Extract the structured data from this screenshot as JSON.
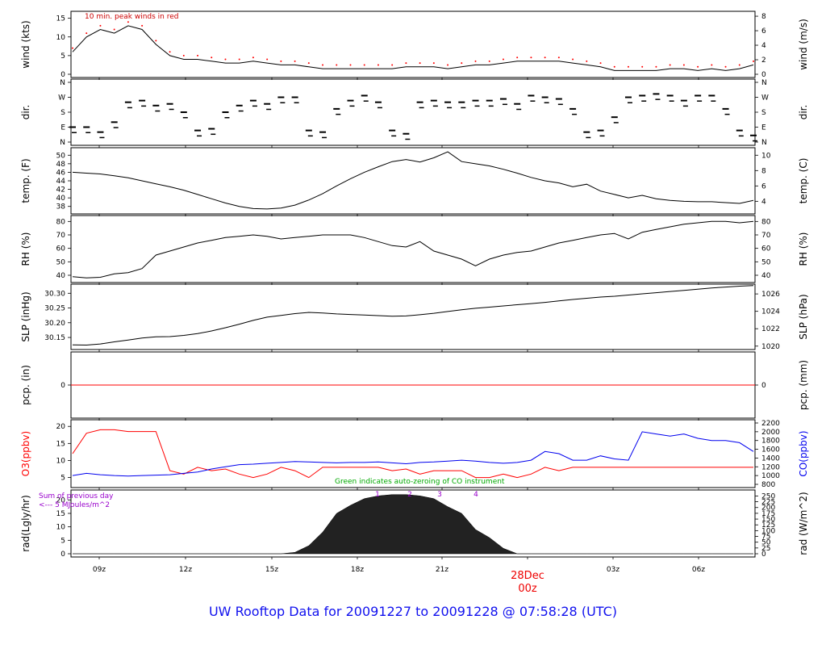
{
  "chart_data": {
    "type": "line",
    "time_ticks": [
      "09z",
      "12z",
      "15z",
      "18z",
      "21z",
      "",
      "03z",
      "06z"
    ],
    "date_label": "28Dec",
    "midnight_label": "00z",
    "panels": [
      {
        "id": "wind",
        "ylabel_left": "wind (kts)",
        "ylabel_right": "wind (m/s)",
        "left_ticks": [
          0,
          5,
          10,
          15
        ],
        "right_ticks": [
          0,
          2,
          4,
          6,
          8
        ],
        "ylim": [
          0,
          16
        ],
        "annotation": "10 min. peak winds in red",
        "series": [
          {
            "values": [
              6,
              10,
              12,
              11,
              13,
              12,
              8,
              5,
              4,
              4,
              3.5,
              3,
              3,
              3.5,
              3,
              2.5,
              2.5,
              2,
              1.5,
              1.5,
              1.5,
              1.5,
              1.5,
              1.5,
              2,
              2,
              2,
              1.5,
              2,
              2.5,
              2.5,
              3,
              3.5,
              3.5,
              3.5,
              3.5,
              3,
              2.5,
              2,
              1,
              1,
              1,
              1,
              1.5,
              1.5,
              1,
              1.5,
              1,
              1.5,
              2.5
            ]
          }
        ]
      },
      {
        "id": "dir",
        "ylabel_left": "dir.",
        "ylabel_right": "dir.",
        "left_ticks": [
          "N",
          "E",
          "S",
          "W",
          "N"
        ],
        "right_ticks": [
          "N",
          "E",
          "S",
          "W",
          "N"
        ],
        "ylim": [
          0,
          360
        ],
        "series": [
          {
            "values": [
              90,
              90,
              60,
              120,
              240,
              250,
              220,
              230,
              180,
              70,
              80,
              180,
              220,
              250,
              230,
              270,
              270,
              70,
              60,
              200,
              250,
              280,
              240,
              70,
              50,
              240,
              250,
              240,
              240,
              250,
              250,
              260,
              230,
              280,
              270,
              260,
              200,
              60,
              70,
              150,
              270,
              280,
              290,
              280,
              250,
              280,
              280,
              200,
              70,
              40
            ]
          }
        ]
      },
      {
        "id": "temp",
        "ylabel_left": "temp. (F)",
        "ylabel_right": "temp. (C)",
        "left_ticks": [
          38,
          40,
          42,
          44,
          46,
          48,
          50
        ],
        "right_ticks": [
          4,
          6,
          8,
          10
        ],
        "ylim": [
          37,
          51
        ],
        "series": [
          {
            "values": [
              46,
              45.8,
              45.6,
              45.2,
              44.7,
              44,
              43.3,
              42.6,
              41.8,
              40.8,
              39.8,
              38.8,
              38,
              37.5,
              37.4,
              37.6,
              38.3,
              39.5,
              41,
              42.8,
              44.5,
              46,
              47.3,
              48.5,
              49,
              48.4,
              49.4,
              50.8,
              48.5,
              48,
              47.5,
              46.7,
              45.8,
              44.8,
              44,
              43.5,
              42.6,
              43.2,
              41.6,
              40.8,
              40,
              40.6,
              39.8,
              39.4,
              39.2,
              39.1,
              39.1,
              38.9,
              38.7,
              39.4
            ]
          }
        ]
      },
      {
        "id": "rh",
        "ylabel_left": "RH (%)",
        "ylabel_right": "RH (%)",
        "left_ticks": [
          40,
          50,
          60,
          70,
          80
        ],
        "right_ticks": [
          40,
          50,
          60,
          70,
          80
        ],
        "ylim": [
          37,
          82
        ],
        "series": [
          {
            "values": [
              39,
              38,
              38.5,
              41,
              42,
              45,
              55,
              58,
              61,
              64,
              66,
              68,
              69,
              70,
              69,
              67,
              68,
              69,
              70,
              70,
              70,
              68,
              65,
              62,
              61,
              65,
              58,
              55,
              52,
              47,
              52,
              55,
              57,
              58,
              61,
              64,
              66,
              68,
              70,
              71,
              67,
              72,
              74,
              76,
              78,
              79,
              80,
              80,
              79,
              80
            ]
          }
        ]
      },
      {
        "id": "slp",
        "ylabel_left": "SLP (inHg)",
        "ylabel_right": "SLP (hPa)",
        "left_ticks": [
          30.15,
          30.2,
          30.25,
          30.3
        ],
        "right_ticks": [
          1020,
          1022,
          1024,
          1026
        ],
        "ylim": [
          30.12,
          30.32
        ],
        "series": [
          {
            "values": [
              30.125,
              30.124,
              30.128,
              30.135,
              30.141,
              30.148,
              30.152,
              30.153,
              30.157,
              30.163,
              30.172,
              30.183,
              30.195,
              30.208,
              30.219,
              30.225,
              30.231,
              30.235,
              30.233,
              30.23,
              30.228,
              30.226,
              30.224,
              30.222,
              30.223,
              30.227,
              30.232,
              30.238,
              30.244,
              30.249,
              30.253,
              30.257,
              30.261,
              30.265,
              30.269,
              30.274,
              30.279,
              30.283,
              30.287,
              30.29,
              30.294,
              30.298,
              30.302,
              30.306,
              30.31,
              30.314,
              30.318,
              30.321,
              30.324,
              30.326
            ]
          }
        ]
      },
      {
        "id": "pcp",
        "ylabel_left": "pcp. (in)",
        "ylabel_right": "pcp. (mm)",
        "left_ticks": [
          0
        ],
        "right_ticks": [
          0
        ],
        "ylim": [
          -1,
          1
        ],
        "series": [
          {
            "values": [
              0,
              0
            ]
          }
        ]
      },
      {
        "id": "chem",
        "ylabel_left": "O3(ppbv)",
        "ylabel_right": "CO(ppbv)",
        "left_ticks": [
          5,
          10,
          15,
          20
        ],
        "right_ticks": [
          800,
          1000,
          1200,
          1400,
          1600,
          1800,
          2000,
          2200
        ],
        "ylim": [
          3,
          21
        ],
        "annotation": "Green indicates auto-zeroing of CO instrument",
        "colors": {
          "o3": "#ff0000",
          "co": "#0000ee",
          "zero": "#00aa00"
        },
        "series": [
          {
            "name": "O3(ppbv)",
            "values": [
              12,
              18,
              19,
              19,
              18.5,
              18.5,
              18.5,
              7,
              6,
              8,
              7,
              7.5,
              6,
              5,
              6,
              8,
              7,
              5,
              8,
              8,
              8,
              8,
              8,
              7,
              7.5,
              6,
              7,
              7,
              7,
              5,
              5,
              6,
              5,
              6,
              8,
              7,
              8,
              8,
              8,
              8,
              8,
              8,
              8,
              8,
              8,
              8,
              8,
              8,
              8,
              8
            ]
          },
          {
            "name": "CO(ppbv)",
            "values": [
              1000,
              1050,
              1020,
              1000,
              990,
              1000,
              1010,
              1020,
              1050,
              1080,
              1150,
              1200,
              1250,
              1260,
              1280,
              1300,
              1320,
              1310,
              1300,
              1290,
              1300,
              1300,
              1310,
              1290,
              1270,
              1300,
              1310,
              1330,
              1350,
              1330,
              1300,
              1280,
              1300,
              1350,
              1550,
              1500,
              1350,
              1350,
              1450,
              1380,
              1350,
              2000,
              1950,
              1900,
              1950,
              1850,
              1800,
              1800,
              1750,
              1550
            ]
          }
        ]
      },
      {
        "id": "rad",
        "ylabel_left": "rad(Lgly/hr)",
        "ylabel_right": "rad (W/m^2)",
        "left_ticks": [
          0,
          5,
          10,
          15,
          20
        ],
        "right_ticks": [
          0,
          25,
          50,
          75,
          100,
          125,
          150,
          175,
          200,
          225,
          250
        ],
        "ylim": [
          0,
          22.5
        ],
        "annotation": "Sum of previous day",
        "annotation2": "<--- 5 MJoules/m^2",
        "markers": [
          "1",
          "2",
          "3",
          "4"
        ],
        "series": [
          {
            "values": [
              0,
              0,
              0,
              0,
              0,
              0,
              0,
              0,
              0,
              0,
              0,
              0,
              0,
              0,
              0,
              0,
              0.5,
              3,
              8,
              15,
              18,
              20.5,
              21.5,
              22,
              22,
              21.5,
              20.5,
              17.5,
              15,
              9,
              6,
              2,
              0,
              0,
              0,
              0,
              0,
              0,
              0,
              0,
              0,
              0,
              0,
              0,
              0,
              0,
              0,
              0,
              0,
              0
            ]
          }
        ]
      }
    ],
    "title": "UW Rooftop Data for 20091227  to  20091228 @ 07:58:28  (UTC)"
  }
}
